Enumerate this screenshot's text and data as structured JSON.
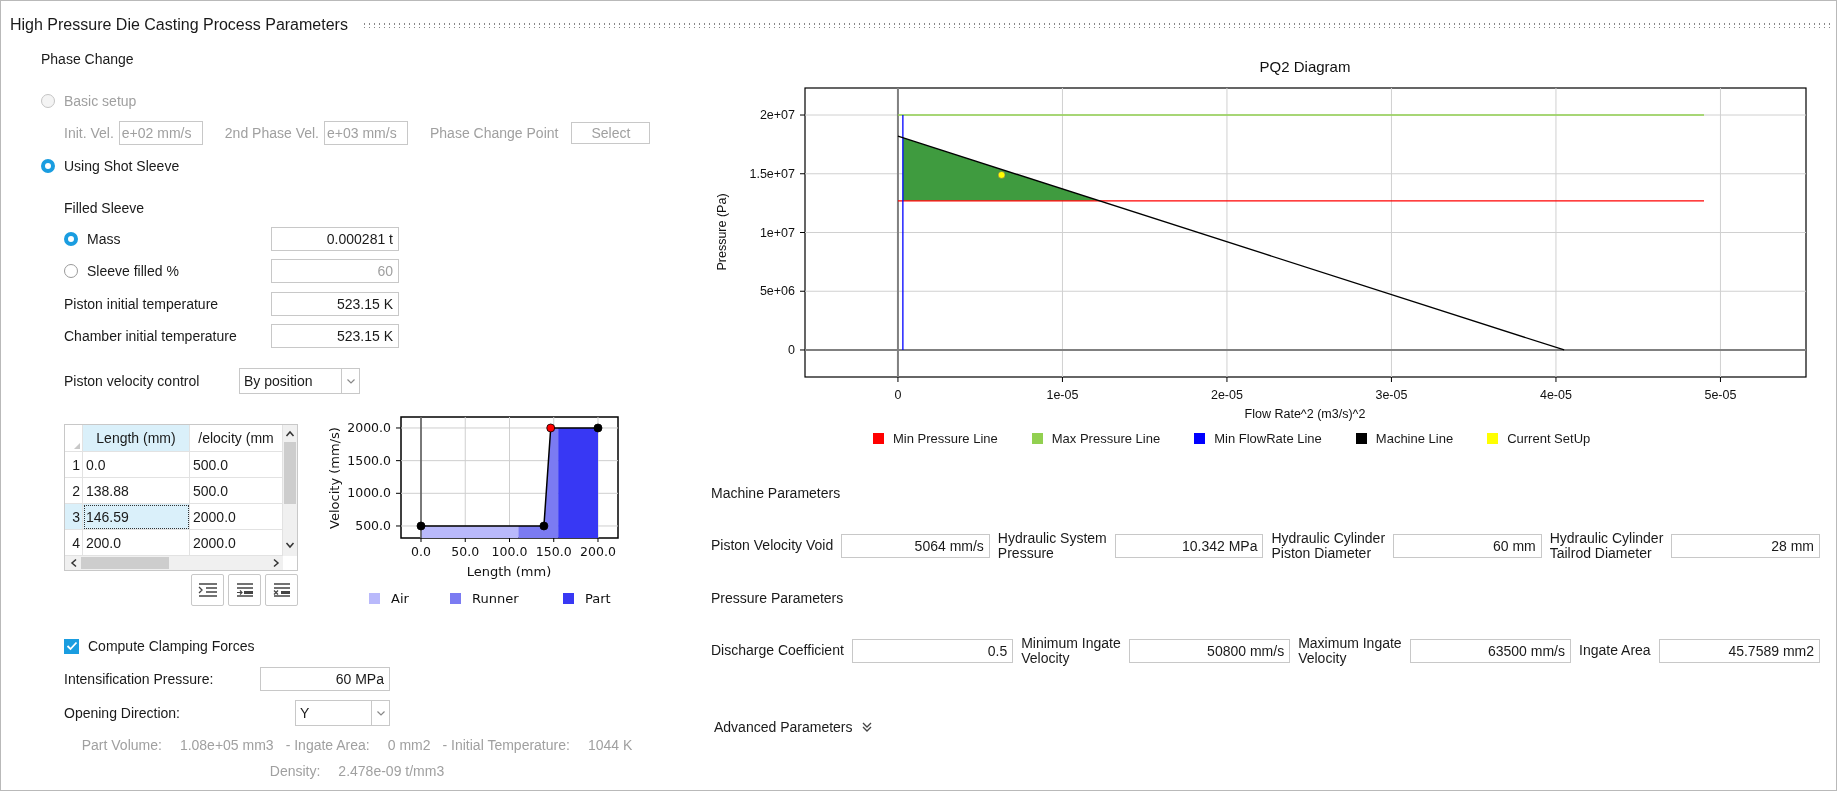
{
  "window": {
    "title": "High Pressure Die Casting Process Parameters"
  },
  "phase_change": {
    "title": "Phase Change",
    "modes": [
      {
        "label": "Basic setup",
        "selected": false,
        "disabled": true
      },
      {
        "label": "Using Shot Sleeve",
        "selected": true,
        "disabled": false
      }
    ],
    "basic_fields": [
      {
        "label": "Init. Vel.",
        "value": "e+02 mm/s"
      },
      {
        "label": "2nd Phase Vel.",
        "value": "e+03 mm/s"
      }
    ],
    "phase_change_point": {
      "label": "Phase Change Point",
      "button": "Select"
    }
  },
  "filled_sleeve": {
    "title": "Filled Sleeve",
    "options": [
      {
        "label": "Mass",
        "value": "0.000281 t",
        "selected": true
      },
      {
        "label": "Sleeve filled %",
        "value": "60",
        "selected": false
      }
    ]
  },
  "temperatures": [
    {
      "label": "Piston initial temperature",
      "value": "523.15 K"
    },
    {
      "label": "Chamber initial temperature",
      "value": "523.15 K"
    }
  ],
  "velocity_control": {
    "label": "Piston velocity control",
    "value": "By position"
  },
  "profile_table": {
    "columns": [
      {
        "label": "Length (mm)",
        "selected": true
      },
      {
        "label": "/elocity (mm",
        "selected": false
      }
    ],
    "rows": [
      {
        "index": "1",
        "length": "0.0",
        "velocity": "500.0",
        "selected": false
      },
      {
        "index": "2",
        "length": "138.88",
        "velocity": "500.0",
        "selected": false
      },
      {
        "index": "3",
        "length": "146.59",
        "velocity": "2000.0",
        "selected": true
      },
      {
        "index": "4",
        "length": "200.0",
        "velocity": "2000.0",
        "selected": false
      }
    ]
  },
  "profile_chart": {
    "chart_data": {
      "type": "area",
      "xlabel": "Length (mm)",
      "ylabel": "Velocity (mm/s)",
      "grid": true,
      "legend": "bottom",
      "series": [
        {
          "name": "Air",
          "color": "#b9b9fb",
          "x": [
            0,
            110
          ],
          "values": [
            500,
            500
          ]
        },
        {
          "name": "Runner",
          "color": "#7b7bf2",
          "x": [
            110,
            138.88,
            146.59,
            155
          ],
          "values": [
            500,
            500,
            2000,
            2000
          ]
        },
        {
          "name": "Part",
          "color": "#3838f4",
          "x": [
            155,
            200
          ],
          "values": [
            2000,
            2000
          ]
        },
        {
          "type": "line",
          "color": "#000000",
          "marker": "circle",
          "x": [
            0,
            138.88,
            146.59,
            200
          ],
          "values": [
            500,
            500,
            2000,
            2000
          ]
        }
      ],
      "xlim": [
        -22.6,
        222.6
      ],
      "ylim": [
        316,
        2168
      ],
      "xticks": [
        {
          "value": 0,
          "label": "0.0"
        },
        {
          "value": 50,
          "label": "50.0"
        },
        {
          "value": 100,
          "label": "100.0"
        },
        {
          "value": 150,
          "label": "150.0"
        },
        {
          "value": 200,
          "label": "200.0"
        }
      ],
      "yticks": [
        {
          "value": 500,
          "label": "500.0"
        },
        {
          "value": 1000,
          "label": "1000.0"
        },
        {
          "value": 1500,
          "label": "1500.0"
        },
        {
          "value": 2000,
          "label": "2000.0"
        }
      ]
    }
  },
  "clamping": {
    "label": "Compute Clamping Forces",
    "checked": true,
    "fields": [
      {
        "label": "Intensification Pressure:",
        "value": "60 MPa",
        "kind": "text"
      },
      {
        "label": "Opening Direction:",
        "value": "Y",
        "kind": "dropdown"
      }
    ]
  },
  "summary_lines": [
    {
      "items": [
        {
          "label": "Part Volume:",
          "value": "1.08e+05 mm3"
        },
        {
          "label": "- Ingate Area:",
          "value": "0 mm2"
        },
        {
          "label": "- Initial Temperature:",
          "value": "1044 K"
        }
      ]
    },
    {
      "items": [
        {
          "label": "Density:",
          "value": "2.478e-09 t/mm3"
        }
      ]
    }
  ],
  "pq2": {
    "chart_data": {
      "type": "line",
      "title": "PQ2 Diagram",
      "grid": true,
      "legend": "bottom",
      "xlabel": "Flow Rate^2 (m3/s)^2",
      "ylabel": "Pressure (Pa)",
      "series": [
        {
          "name": "Min Pressure Line",
          "color": "#ff0000",
          "x": [
            0,
            4.9e-05
          ],
          "values": [
            12700000,
            12700000
          ]
        },
        {
          "name": "Max Pressure Line",
          "color": "#92d050",
          "x": [
            0,
            4.9e-05
          ],
          "values": [
            20000000,
            20000000
          ]
        },
        {
          "name": "Min FlowRate Line",
          "color": "#0000ff",
          "x": [
            3e-07,
            3e-07
          ],
          "values": [
            0,
            20000000
          ]
        },
        {
          "name": "Machine Line",
          "color": "#000000",
          "x": [
            0,
            4.05e-05
          ],
          "values": [
            18200000,
            0
          ]
        },
        {
          "name": "Current SetUp",
          "color": "#ffff00",
          "marker": "circle",
          "x": [
            6.3e-06
          ],
          "values": [
            14900000
          ]
        }
      ],
      "xlim": [
        -5.65e-06,
        5.52e-05
      ],
      "ylim": [
        -2300000,
        22300000
      ],
      "xticks": [
        {
          "value": 0,
          "label": "0"
        },
        {
          "value": 1e-05,
          "label": "1e-05"
        },
        {
          "value": 2e-05,
          "label": "2e-05"
        },
        {
          "value": 3e-05,
          "label": "3e-05"
        },
        {
          "value": 4e-05,
          "label": "4e-05"
        },
        {
          "value": 5e-05,
          "label": "5e-05"
        }
      ],
      "yticks": [
        {
          "value": 0,
          "label": "0"
        },
        {
          "value": 5000000,
          "label": "5e+06"
        },
        {
          "value": 10000000,
          "label": "1e+07"
        },
        {
          "value": 15000000,
          "label": "1.5e+07"
        },
        {
          "value": 20000000,
          "label": "2e+07"
        }
      ]
    }
  },
  "parameter_sections": [
    {
      "title": "Machine Parameters",
      "fields": [
        {
          "label": "Piston Velocity Void",
          "value": "5064 mm/s"
        },
        {
          "label": "Hydraulic System\nPressure",
          "value": "10.342 MPa"
        },
        {
          "label": "Hydraulic Cylinder\nPiston Diameter",
          "value": "60 mm"
        },
        {
          "label": "Hydraulic Cylinder\nTailrod Diameter",
          "value": "28 mm"
        }
      ]
    },
    {
      "title": "Pressure Parameters",
      "fields": [
        {
          "label": "Discharge Coefficient",
          "value": "0.5"
        },
        {
          "label": "Minimum Ingate\nVelocity",
          "value": "50800 mm/s"
        },
        {
          "label": "Maximum Ingate\nVelocity",
          "value": "63500 mm/s"
        },
        {
          "label": "Ingate Area",
          "value": "45.7589 mm2"
        }
      ]
    }
  ],
  "advanced": {
    "label": "Advanced Parameters",
    "expanded": false
  }
}
